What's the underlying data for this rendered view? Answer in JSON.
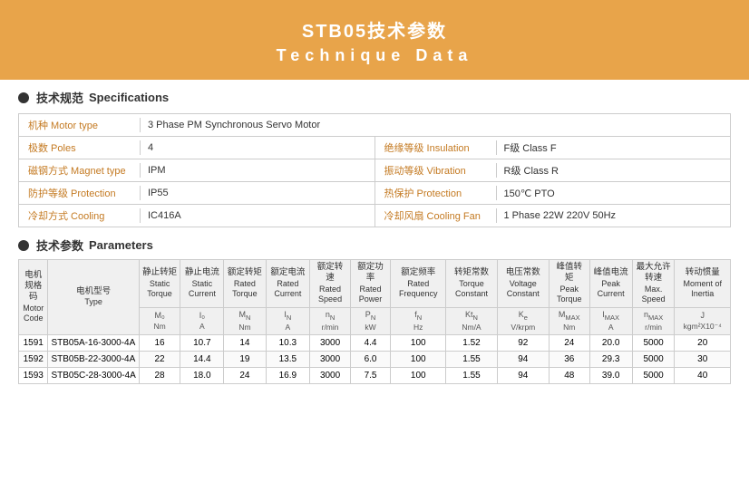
{
  "header": {
    "title_zh": "STB05技术参数",
    "title_en": "Technique  Data"
  },
  "specs_section": {
    "dot": true,
    "label_zh": "技术规范",
    "label_en": "Specifications",
    "rows": [
      {
        "left_label": "机种 Motor type",
        "left_value": "3 Phase PM Synchronous Servo Motor",
        "has_right": false
      },
      {
        "left_label": "极数 Poles",
        "left_value": "4",
        "has_right": true,
        "right_label": "绝缘等级 Insulation",
        "right_value": "F级  Class F"
      },
      {
        "left_label": "磁钢方式 Magnet type",
        "left_value": "IPM",
        "has_right": true,
        "right_label": "振动等级 Vibration",
        "right_value": "R级  Class R"
      },
      {
        "left_label": "防护等级 Protection",
        "left_value": "IP55",
        "has_right": true,
        "right_label": "热保护 Protection",
        "right_value": "150℃ PTO"
      },
      {
        "left_label": "冷却方式 Cooling",
        "left_value": "IC416A",
        "has_right": true,
        "right_label": "冷却风扇 Cooling Fan",
        "right_value": "1 Phase  22W  220V  50Hz"
      }
    ]
  },
  "params_section": {
    "label_zh": "技术参数",
    "label_en": "Parameters",
    "columns": [
      {
        "zh": "电机\n规格码",
        "en": "Motor\nCode",
        "sub": "",
        "unit": ""
      },
      {
        "zh": "电机型号",
        "en": "Type",
        "sub": "",
        "unit": ""
      },
      {
        "zh": "静止转矩",
        "en": "Static\nTorque",
        "sub": "M₀",
        "unit": "Nm"
      },
      {
        "zh": "静止电流",
        "en": "Static\nCurrent",
        "sub": "I₀",
        "unit": "A"
      },
      {
        "zh": "额定转矩",
        "en": "Rated\nTorque",
        "sub": "MN",
        "unit": "Nm"
      },
      {
        "zh": "额定电流",
        "en": "Rated\nCurrent",
        "sub": "IN",
        "unit": "A"
      },
      {
        "zh": "额定转速",
        "en": "Rated\nSpeed",
        "sub": "nN",
        "unit": "r/min"
      },
      {
        "zh": "额定功率",
        "en": "Rated\nPower",
        "sub": "PN",
        "unit": "kW"
      },
      {
        "zh": "额定频率",
        "en": "Rated\nFrequency",
        "sub": "fN",
        "unit": "Hz"
      },
      {
        "zh": "转矩常数",
        "en": "Torque\nConstant",
        "sub": "KtN",
        "unit": "Nm/A"
      },
      {
        "zh": "电压常数",
        "en": "Voltage\nConstant",
        "sub": "Ke",
        "unit": "V/krpm"
      },
      {
        "zh": "峰值转矩",
        "en": "Peak\nTorque",
        "sub": "MMAX",
        "unit": "Nm"
      },
      {
        "zh": "峰值电流",
        "en": "Peak\nCurrent",
        "sub": "IMAX",
        "unit": "A"
      },
      {
        "zh": "最大允许转速",
        "en": "Max.\nSpeed",
        "sub": "nMAX",
        "unit": "r/min"
      },
      {
        "zh": "转动惯量",
        "en": "Moment\nof Inertia",
        "sub": "J",
        "unit": "kgm²X10⁻⁴"
      }
    ],
    "rows": [
      {
        "code": "1591",
        "type": "STB05A-16-3000-4A",
        "vals": [
          "16",
          "10.7",
          "14",
          "10.3",
          "3000",
          "4.4",
          "100",
          "1.52",
          "92",
          "24",
          "20.0",
          "5000",
          "20"
        ]
      },
      {
        "code": "1592",
        "type": "STB05B-22-3000-4A",
        "vals": [
          "22",
          "14.4",
          "19",
          "13.5",
          "3000",
          "6.0",
          "100",
          "1.55",
          "94",
          "36",
          "29.3",
          "5000",
          "30"
        ]
      },
      {
        "code": "1593",
        "type": "STB05C-28-3000-4A",
        "vals": [
          "28",
          "18.0",
          "24",
          "16.9",
          "3000",
          "7.5",
          "100",
          "1.55",
          "94",
          "48",
          "39.0",
          "5000",
          "40"
        ]
      }
    ]
  }
}
